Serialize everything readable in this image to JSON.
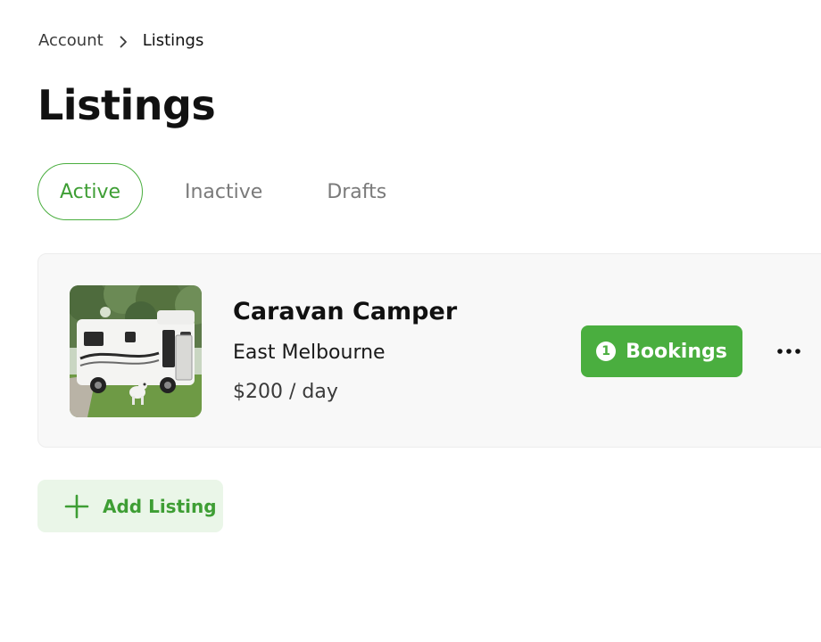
{
  "breadcrumb": {
    "parent": "Account",
    "current": "Listings",
    "separator_icon": "chevron-right-icon"
  },
  "page_title": "Listings",
  "tabs": [
    {
      "label": "Active",
      "selected": true
    },
    {
      "label": "Inactive",
      "selected": false
    },
    {
      "label": "Drafts",
      "selected": false
    }
  ],
  "listing": {
    "photo_icon": "caravan-photo",
    "title": "Caravan Camper",
    "location": "East Melbourne",
    "price": "$200 / day",
    "bookings": {
      "count": "1",
      "label": "Bookings"
    },
    "more_icon": "more-horizontal-icon"
  },
  "add_listing": {
    "icon": "plus-icon",
    "label": "Add Listing"
  },
  "colors": {
    "accent": "#4aae3f",
    "accent_text": "#3e9e34",
    "accent_light": "#eaf6e8",
    "card_bg": "#f8f8f8",
    "muted_text": "#7a7a7a"
  }
}
